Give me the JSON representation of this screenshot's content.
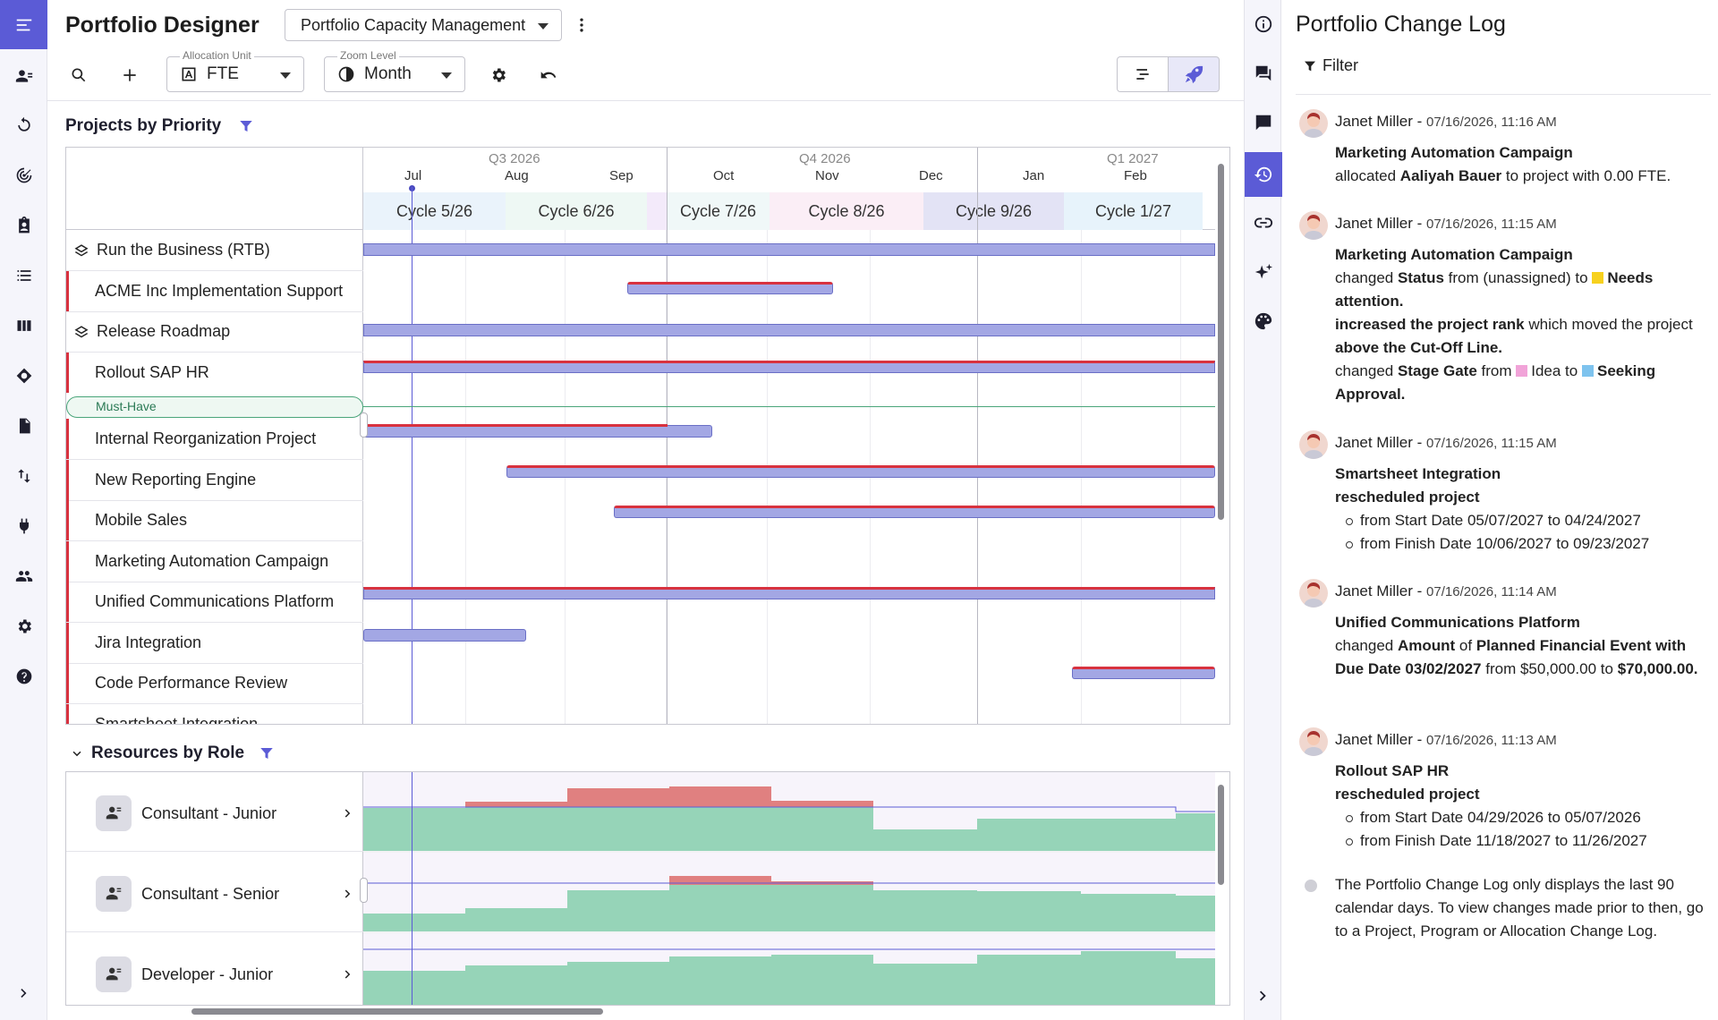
{
  "app": {
    "name": "Portfolio Designer"
  },
  "toolbar": {
    "view_selector": "Portfolio Capacity Management",
    "allocation_unit_label": "Allocation Unit",
    "allocation_unit_value": "FTE",
    "zoom_label": "Zoom Level",
    "zoom_value": "Month"
  },
  "projects": {
    "title": "Projects by Priority",
    "quarters": [
      "Q3 2026",
      "Q4 2026",
      "Q1 2027"
    ],
    "months": [
      "Jul",
      "Aug",
      "Sep",
      "Oct",
      "Nov",
      "Dec",
      "Jan",
      "Feb"
    ],
    "cycles": [
      "Cycle 5/26",
      "Cycle 6/26",
      "Cycle 7/26",
      "Cycle 8/26",
      "Cycle 9/26",
      "Cycle 1/27"
    ],
    "rows": [
      "Run the Business (RTB)",
      "ACME Inc Implementation Support",
      "Release Roadmap",
      "Rollout SAP HR",
      "Internal Reorganization Project",
      "New Reporting Engine",
      "Mobile Sales",
      "Marketing Automation Campaign",
      "Unified Communications Platform",
      "Jira Integration",
      "Code Performance Review",
      "Smartsheet Integration"
    ],
    "cutoff_label": "Must-Have"
  },
  "resources": {
    "title": "Resources by Role",
    "roles": [
      "Consultant - Junior",
      "Consultant - Senior",
      "Developer - Junior"
    ]
  },
  "changelog": {
    "title": "Portfolio Change Log",
    "filter_label": "Filter",
    "entries": [
      {
        "user": "Janet Miller",
        "time": "07/16/2026, 11:16 AM",
        "project": "Marketing Automation Campaign",
        "l1": "allocated",
        "l1b": "Aaliyah Bauer",
        "l1c": "to project with 0.00 FTE."
      },
      {
        "user": "Janet Miller",
        "time": "07/16/2026, 11:15 AM",
        "project": "Marketing Automation Campaign",
        "a1": "changed",
        "a2": "Status",
        "a3": "from (unassigned) to",
        "a4": "Needs attention.",
        "b1": "increased the project rank",
        "b2": "which moved the project",
        "b3": "above the Cut-Off Line.",
        "c1": "changed",
        "c2": "Stage Gate",
        "c3": "from",
        "c4": "Idea to",
        "c5": "Seeking Approval."
      },
      {
        "user": "Janet Miller",
        "time": "07/16/2026, 11:15 AM",
        "project": "Smartsheet Integration",
        "action": "rescheduled project",
        "d1": "from Start Date 05/07/2027 to 04/24/2027",
        "d2": "from Finish Date 10/06/2027 to 09/23/2027"
      },
      {
        "user": "Janet Miller",
        "time": "07/16/2026, 11:14 AM",
        "project": "Unified Communications Platform",
        "e1": "changed",
        "e2": "Amount",
        "e3": "of",
        "e4": "Planned Financial Event with Due Date 03/02/2027",
        "e5": "from $50,000.00 to",
        "e6": "$70,000.00."
      },
      {
        "user": "Janet Miller",
        "time": "07/16/2026, 11:13 AM",
        "project": "Rollout SAP HR",
        "action": "rescheduled project",
        "d1": "from Start Date 04/29/2026 to 05/07/2026",
        "d2": "from Finish Date 11/18/2027 to 11/26/2027"
      }
    ],
    "footer_note": "The Portfolio Change Log only displays the last 90 calendar days. To view changes made prior to then, go to a Project, Program or Allocation Change Log."
  },
  "colors": {
    "accent": "#5b5bd6",
    "bar": "#a3a7e4",
    "over": "#d8323f",
    "capacity": "#96d4b8",
    "overalloc": "#e08080"
  }
}
